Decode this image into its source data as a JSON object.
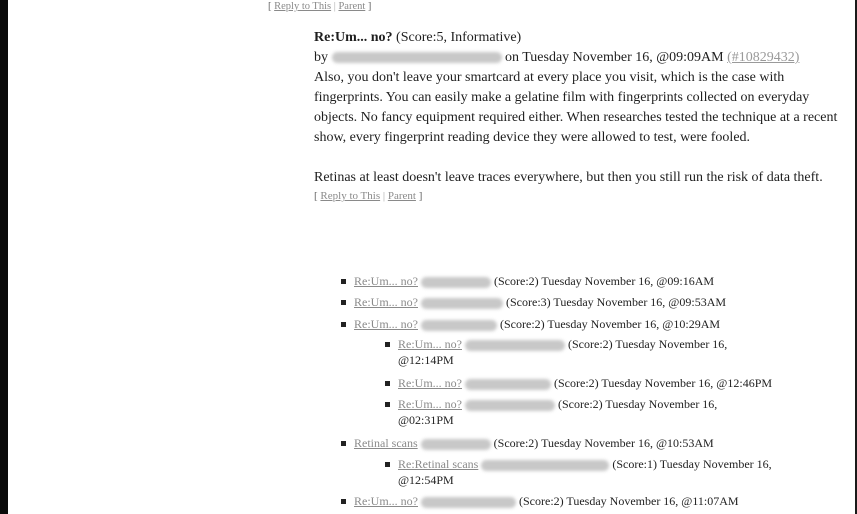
{
  "top_links": {
    "reply": "Reply to This",
    "sep": "|",
    "parent": "Parent",
    "open": "[",
    "close": "]"
  },
  "post": {
    "title": "Re:Um... no?",
    "score": "(Score:5, Informative)",
    "by": "by",
    "posted": "on Tuesday November 16, @09:09AM",
    "ip": "(#10829432)",
    "paragraph1": "Also, you don't leave your smartcard at every place you visit, which is the case with fingerprints. You can easily make a gelatine film with fingerprints collected on everyday objects. No fancy equipment required either. When researches tested the technique at a recent show, every fingerprint reading device they were allowed to test, were fooled.",
    "paragraph2": "Retinas at least doesn't leave traces everywhere, but then you still run the risk of data theft.",
    "reply_link": "Reply to This",
    "parent_link": "Parent",
    "open": "[",
    "close": "]",
    "sep": "|"
  },
  "replies": [
    {
      "title": "Re:Um... no?",
      "meta": "(Score:2) Tuesday November 16, @09:16AM"
    },
    {
      "title": "Re:Um... no?",
      "meta": "(Score:3) Tuesday November 16, @09:53AM"
    },
    {
      "title": "Re:Um... no?",
      "meta": "(Score:2) Tuesday November 16, @10:29AM"
    },
    {
      "title": "Re:Um... no?",
      "meta": "(Score:2) Tuesday November 16,",
      "meta2": "@12:14PM"
    },
    {
      "title": "Re:Um... no?",
      "meta": "(Score:2) Tuesday November 16, @12:46PM"
    },
    {
      "title": "Re:Um... no?",
      "meta": "(Score:2) Tuesday November 16,",
      "meta2": "@02:31PM"
    },
    {
      "title": "Retinal scans",
      "meta": "(Score:2) Tuesday November 16, @10:53AM"
    },
    {
      "title": "Re:Retinal scans",
      "meta": "(Score:1) Tuesday November 16,",
      "meta2": "@12:54PM"
    },
    {
      "title": "Re:Um... no?",
      "meta": "(Score:2) Tuesday November 16, @11:07AM"
    }
  ]
}
